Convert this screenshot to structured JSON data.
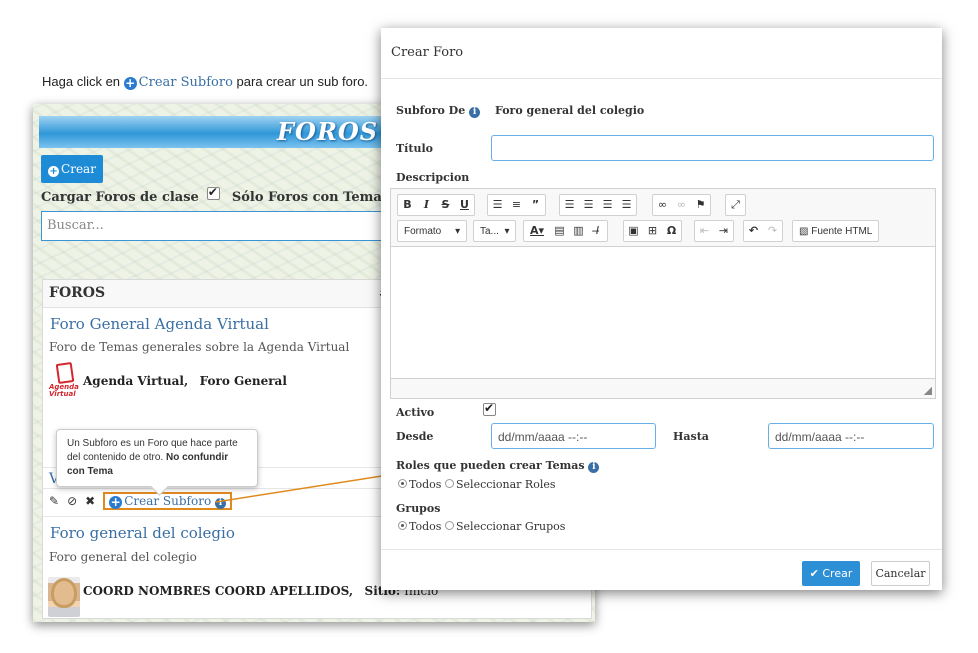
{
  "caption": {
    "before": "Haga click en",
    "link": "Crear Subforo",
    "after": "para crear un sub foro."
  },
  "background": {
    "banner_title": "FOROS",
    "create_button": "Crear",
    "filters": {
      "class_forums": "Cargar Foros de clase",
      "class_forums_checked": true,
      "only_topics": "Sólo Foros con Temas",
      "only_topics_checked": false
    },
    "search_placeholder": "Buscar...",
    "list_header": "FOROS",
    "list_header_extra": "#",
    "forums": [
      {
        "title": "Foro General Agenda Virtual",
        "description": "Foro de Temas generales sobre la Agenda Virtual",
        "author": "Agenda Virtual,",
        "section": "Foro General",
        "logo_text": "Agenda Virtual"
      },
      {
        "title": "Foro general del colegio",
        "description": "Foro general del colegio",
        "author": "COORD NOMBRES COORD APELLIDOS,",
        "site_label": "Sitio:",
        "site_value": "Inicio"
      }
    ],
    "partial_letter": "V",
    "subforo_link": "Crear Subforo",
    "tooltip": {
      "text": "Un Subforo es un Foro que hace parte del contenido de otro.",
      "bold": "No confundir con Tema"
    }
  },
  "modal": {
    "title": "Crear Foro",
    "subforo_de_label": "Subforo De",
    "subforo_de_value": "Foro general del colegio",
    "titulo_label": "Título",
    "titulo_value": "",
    "descripcion_label": "Descripcion",
    "toolbar": {
      "formato": "Formato",
      "tamano": "Ta...",
      "fuente_html": "Fuente HTML"
    },
    "activo_label": "Activo",
    "activo_checked": true,
    "desde_label": "Desde",
    "desde_placeholder": "dd/mm/aaaa --:--",
    "hasta_label": "Hasta",
    "hasta_placeholder": "dd/mm/aaaa --:--",
    "roles_label": "Roles que pueden crear Temas",
    "roles_options": [
      "Todos",
      "Seleccionar Roles"
    ],
    "roles_selected": "Todos",
    "grupos_label": "Grupos",
    "grupos_options": [
      "Todos",
      "Seleccionar Grupos"
    ],
    "grupos_selected": "Todos",
    "submit_label": "Crear",
    "cancel_label": "Cancelar"
  },
  "colors": {
    "primary": "#2d8fd6",
    "link": "#3a6fa5",
    "highlight": "#e08a1e",
    "banner": "#2f97d8"
  }
}
